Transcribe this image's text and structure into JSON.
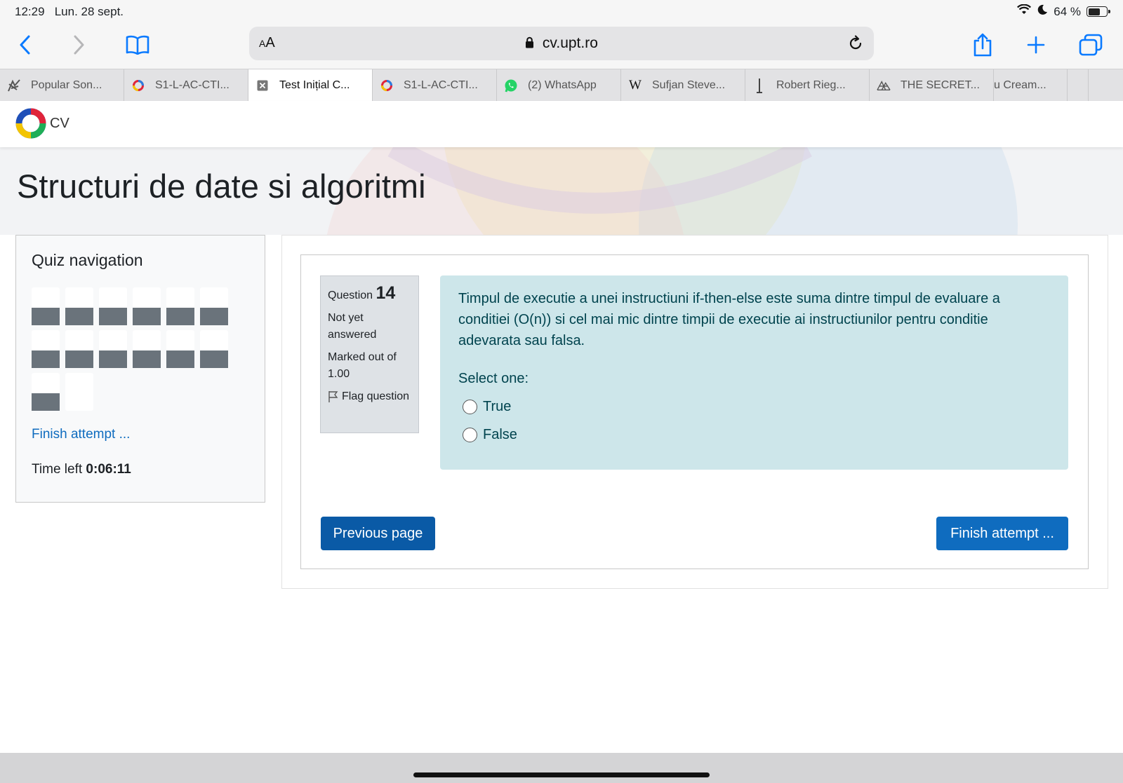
{
  "status": {
    "time": "12:29",
    "date": "Lun. 28 sept.",
    "battery": "64 %",
    "battery_level": 0.64
  },
  "toolbar": {
    "text_size": "AA",
    "url": "cv.upt.ro"
  },
  "tabs": [
    {
      "label": "Popular Son...",
      "icon": "scatter-favicon"
    },
    {
      "label": "S1-L-AC-CTI...",
      "icon": "ring-favicon"
    },
    {
      "label": "Test Inițial C...",
      "icon": "close-icon",
      "active": true
    },
    {
      "label": "S1-L-AC-CTI...",
      "icon": "ring-favicon"
    },
    {
      "label": "(2) WhatsApp",
      "icon": "whatsapp-icon"
    },
    {
      "label": "Sufjan Steve...",
      "icon": "wikipedia-icon"
    },
    {
      "label": "Robert Rieg...",
      "icon": "cursor-icon"
    },
    {
      "label": "THE SECRET...",
      "icon": "mountain-icon"
    },
    {
      "label": "u Cream..."
    }
  ],
  "site": {
    "brand": "CV",
    "course_title": "Structuri de date si algoritmi"
  },
  "quiz_nav": {
    "heading": "Quiz navigation",
    "question_count": 13,
    "finish_link": "Finish attempt ...",
    "time_label": "Time left",
    "time_value": "0:06:11"
  },
  "question": {
    "label": "Question",
    "number": "14",
    "status": "Not yet answered",
    "marked": "Marked out of 1.00",
    "flag": "Flag question",
    "text": "Timpul de executie a unei instructiuni if-then-else este suma dintre timpul de evaluare a conditiei (O(n)) si cel mai mic dintre timpii de executie ai instructiunilor pentru conditie adevarata sau falsa.",
    "prompt": "Select one:",
    "options": [
      "True",
      "False"
    ]
  },
  "buttons": {
    "previous": "Previous page",
    "finish": "Finish attempt ..."
  },
  "colors": {
    "accent": "#0f6cbf",
    "question_bg": "#cde6ea",
    "nav_button": "#6a737b"
  }
}
